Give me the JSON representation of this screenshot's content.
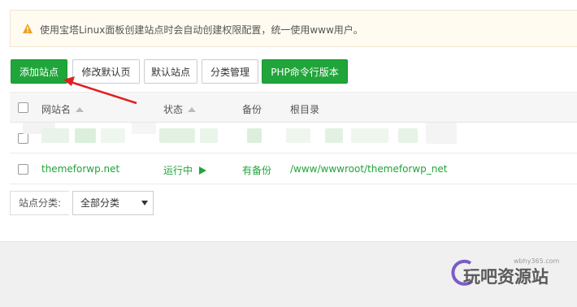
{
  "notice": {
    "text": "使用宝塔Linux面板创建站点时会自动创建权限配置，统一使用www用户。",
    "icon": "warning-icon"
  },
  "toolbar": {
    "add_site": "添加站点",
    "edit_default_page": "修改默认页",
    "default_site": "默认站点",
    "category_manage": "分类管理",
    "php_cli_version": "PHP命令行版本"
  },
  "table": {
    "headers": {
      "site_name": "网站名",
      "status": "状态",
      "backup": "备份",
      "root_dir": "根目录"
    },
    "rows": [
      {
        "name": "themeforwp.net",
        "status": "运行中",
        "status_icon": "play-icon",
        "backup": "有备份",
        "root": "/www/wwwroot/themeforwp_net"
      }
    ]
  },
  "filter": {
    "label": "站点分类:",
    "selected": "全部分类"
  },
  "watermark": {
    "domain": "wbhy365.com",
    "name": "玩吧资源站"
  },
  "colors": {
    "accent_green": "#20a53a",
    "arrow_red": "#e02020",
    "notice_bg": "#fffbf0"
  }
}
